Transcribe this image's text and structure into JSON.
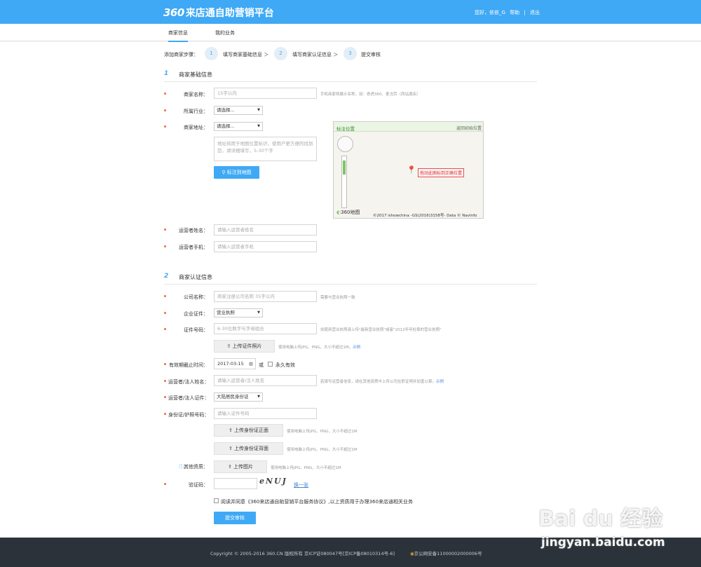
{
  "header": {
    "logo_num": "360",
    "logo_text": "来店通自助营销平台",
    "greeting": "您好，依依_G",
    "help": "帮助",
    "logout": "退出",
    "sep": "|"
  },
  "nav": {
    "tab1": "商家信息",
    "tab2": "我的业务"
  },
  "steps": {
    "label": "添加商家步骤：",
    "s1_num": "1",
    "s1": "填写商家基础信息 ＞",
    "s2_num": "2",
    "s2": "填写商家认证信息 ＞",
    "s3_num": "3",
    "s3": "提交审核"
  },
  "section1": {
    "num": "1",
    "title": "商家基础信息",
    "name_label": "商家名称：",
    "name_placeholder": "15字以内",
    "name_hint": "手机商家将展示名称，如：奇虎360、麦当劳（西站酒店）",
    "industry_label": "所属行业：",
    "industry_value": "请选择...",
    "address_label": "商家地址：",
    "address_value": "请选择...",
    "address_placeholder": "地址将用于地图位置标识，使用户更方便的找到您，请详细填写，5-30个字",
    "map_button": "标注到地图",
    "map_title": "标注位置",
    "map_reset": "返回初始位置",
    "map_tip": "拖动此图标到正确位置",
    "map_logo": "360地图",
    "map_copyright": "©2017 ishowchina -GS(2016)3158号- Data © NavInfo",
    "operator_label": "运营者姓名：",
    "operator_placeholder": "请输入运营者姓名",
    "phone_label": "运营者手机：",
    "phone_placeholder": "请输入运营者手机"
  },
  "section2": {
    "num": "2",
    "title": "商家认证信息",
    "company_label": "公司名称：",
    "company_placeholder": "商家注册公司名称 35字以内",
    "company_hint": "需要与营业执照一致",
    "cert_label": "企业证件：",
    "cert_value": "营业执照",
    "certno_label": "证件号码：",
    "certno_placeholder": "6-30位数字与字母组合",
    "certno_hint": "如使用营业执照请上传\"最新营业执照\"或者\"2012年年检章的营业执照\"",
    "upload_cert": "上传证件照片",
    "upload_cert_hint": "使用电脑上传JPG、PNG，大小不超过1M。",
    "example": "示例",
    "expiry_label": "有效期截止时间：",
    "expiry_value": "2017-03-15",
    "or": "或",
    "forever": "永久有效",
    "legal_label": "运营者/法人姓名：",
    "legal_placeholder": "请输入运营者/法人姓名",
    "legal_hint": "若填写运营者信息，请在其他资质中上传公司在职证明并加盖公章。",
    "legal_cert_label": "运营者/法人证件：",
    "legal_cert_value": "大陆居民身份证",
    "id_label": "身份证/护照号码：",
    "id_placeholder": "请输入证件号码",
    "upload_front": "上传身份证正面",
    "upload_back": "上传身份证背面",
    "upload_id_hint": "使用电脑上传JPG、PNG，大小不超过1M",
    "other_label": "其他资质：",
    "upload_other": "上传图片",
    "upload_other_hint": "使用电脑上传JPG、PNG，大小不超过1M",
    "captcha_label": "验证码：",
    "captcha_text": "eNUJ",
    "captcha_refresh": "换一张",
    "agree_text": "阅读并同意《360来店通自助营销平台服务协议》,以上资质用于办理360来店通相关业务",
    "submit": "提交审核"
  },
  "footer": {
    "text": "Copyright © 2005-2016 360.CN 版权所有  京ICP证080047号[京ICP备08010314号-6]",
    "police": "京公网安备11000002000006号"
  },
  "watermark": {
    "line1": "Bai du 经验",
    "line2": "jingyan.baidu.com"
  },
  "colors": {
    "primary": "#3fa9f5",
    "required": "#f26b3a",
    "footer_bg": "#2b323a"
  }
}
